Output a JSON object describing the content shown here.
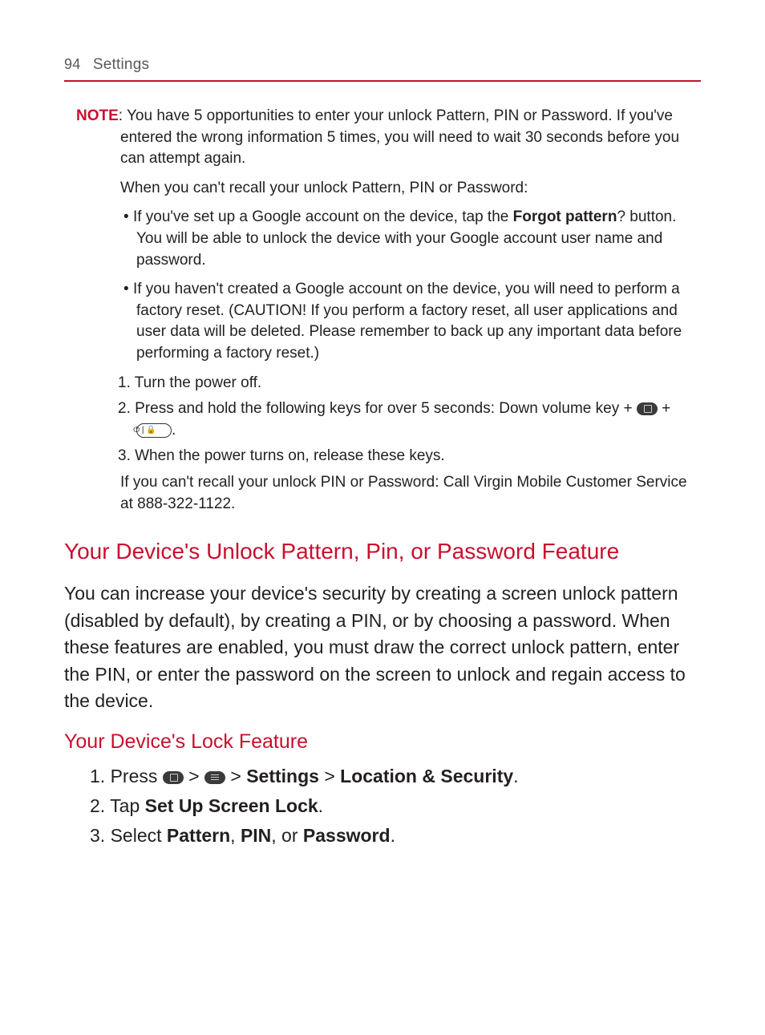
{
  "header": {
    "page_number": "94",
    "section": "Settings"
  },
  "note": {
    "label": "NOTE",
    "text1": ": You have 5 opportunities to enter your unlock Pattern, PIN or Password. If you've entered the wrong information 5 times, you will need to wait 30 seconds before you can attempt again.",
    "para_recall": "When you can't recall your unlock Pattern, PIN or Password:",
    "bullet1_pre": "If you've set up a Google account on the device, tap the ",
    "bullet1_bold": "Forgot pattern",
    "bullet1_post": "? button. You will be able to unlock the device with your Google account user name and password.",
    "bullet2": "If you haven't created a Google account on the device, you will need to perform a factory reset. (CAUTION! If you perform a factory reset, all user applications and user data will be deleted. Please remember to back up any important data before performing a factory reset.)",
    "step1_num": "1. ",
    "step1": "Turn the power off.",
    "step2_num": "2. ",
    "step2_pre": "Press and hold the following keys for over 5 seconds: Down volume key + ",
    "step2_plus": " + ",
    "step2_end": ".",
    "step3_num": "3. ",
    "step3": "When the power turns on, release these keys.",
    "para_pin": "If you can't recall your unlock PIN or Password: Call Virgin Mobile Customer Service at 888-322-1122."
  },
  "section1": {
    "heading": "Your Device's Unlock Pattern, Pin, or Password Feature",
    "body": "You can increase your device's security by creating a screen unlock pattern (disabled by default), by creating a PIN, or by choosing a password. When these features are enabled, you must draw the correct unlock pattern, enter the PIN, or enter the password on the screen to unlock and regain access to the device."
  },
  "section2": {
    "heading": "Your Device's Lock Feature",
    "step1_num": "1. ",
    "step1_pre": "Press ",
    "step1_gt": " > ",
    "step1_settings": "Settings",
    "step1_loc": "Location & Security",
    "step1_end": ".",
    "step2_num": "2. ",
    "step2_pre": "Tap ",
    "step2_bold": "Set Up Screen Lock",
    "step2_end": ".",
    "step3_num": "3. ",
    "step3_pre": "Select ",
    "step3_b1": "Pattern",
    "step3_c1": ", ",
    "step3_b2": "PIN",
    "step3_c2": ", or ",
    "step3_b3": "Password",
    "step3_end": "."
  }
}
